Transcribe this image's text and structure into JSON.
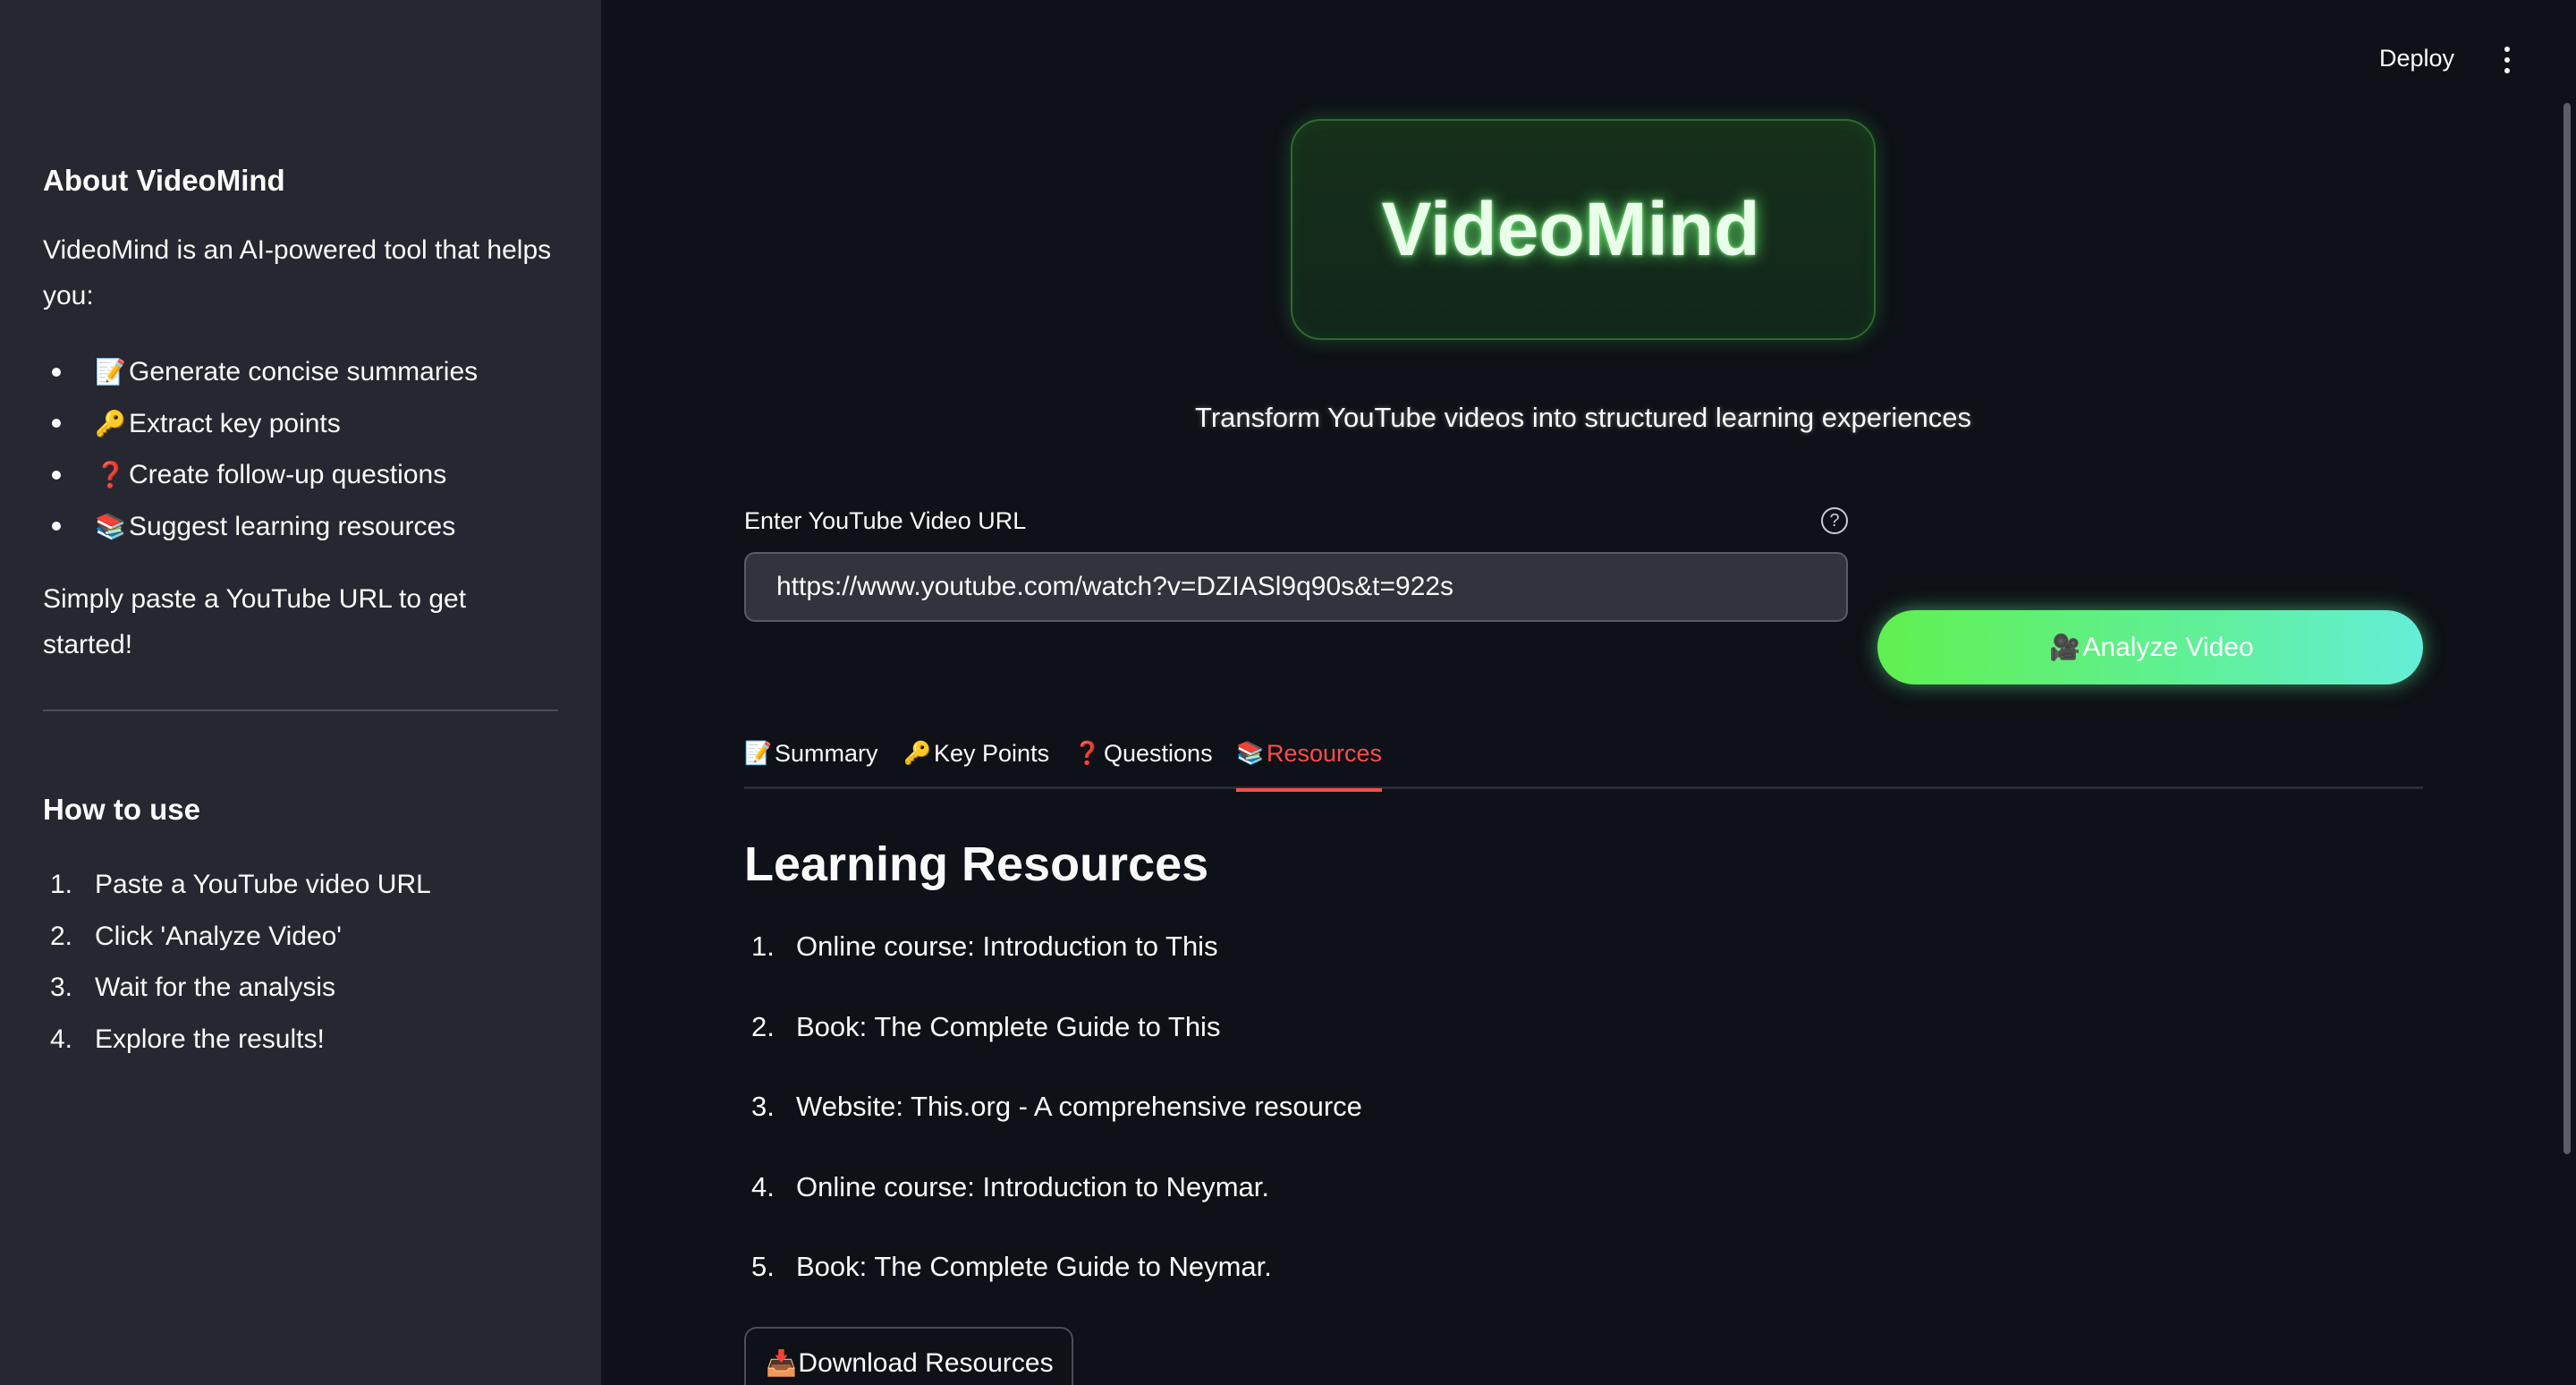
{
  "header": {
    "deploy_label": "Deploy",
    "menu_icon": "kebab-menu-icon"
  },
  "sidebar": {
    "about_title": "About VideoMind",
    "about_text": "VideoMind is an AI-powered tool that helps you:",
    "features": [
      {
        "icon": "📝",
        "label": "Generate concise summaries"
      },
      {
        "icon": "🔑",
        "label": "Extract key points"
      },
      {
        "icon": "❓",
        "label": "Create follow-up questions"
      },
      {
        "icon": "📚",
        "label": "Suggest learning resources"
      }
    ],
    "cta_text": "Simply paste a YouTube URL to get started!",
    "howto_title": "How to use",
    "steps": [
      {
        "num": "1.",
        "label": "Paste a YouTube video URL"
      },
      {
        "num": "2.",
        "label": "Click 'Analyze Video'"
      },
      {
        "num": "3.",
        "label": "Wait for the analysis"
      },
      {
        "num": "4.",
        "label": "Explore the results!"
      }
    ]
  },
  "main": {
    "logo_text": "VideoMind",
    "tagline": "Transform YouTube videos into structured learning experiences",
    "url_label": "Enter YouTube Video URL",
    "url_value": "https://www.youtube.com/watch?v=DZIASl9q90s&t=922s",
    "help_icon": "?",
    "analyze_button": {
      "icon": "🎥",
      "label": "Analyze Video"
    },
    "tabs": [
      {
        "icon": "📝",
        "label": "Summary"
      },
      {
        "icon": "🔑",
        "label": "Key Points"
      },
      {
        "icon": "❓",
        "label": "Questions"
      },
      {
        "icon": "📚",
        "label": "Resources"
      }
    ],
    "active_tab": "Resources",
    "resources_title": "Learning Resources",
    "resources": [
      {
        "num": "1.",
        "label": "Online course: Introduction to This"
      },
      {
        "num": "2.",
        "label": "Book: The Complete Guide to This"
      },
      {
        "num": "3.",
        "label": "Website: This.org - A comprehensive resource"
      },
      {
        "num": "4.",
        "label": "Online course: Introduction to Neymar."
      },
      {
        "num": "5.",
        "label": "Book: The Complete Guide to Neymar."
      }
    ],
    "download_button": {
      "icon": "📥",
      "label": "Download Resources"
    }
  },
  "colors": {
    "background": "#0e1117",
    "sidebar": "#262730",
    "accent": "#ff4b4b",
    "button_gradient_start": "#60f050",
    "button_gradient_end": "#64eed8"
  }
}
